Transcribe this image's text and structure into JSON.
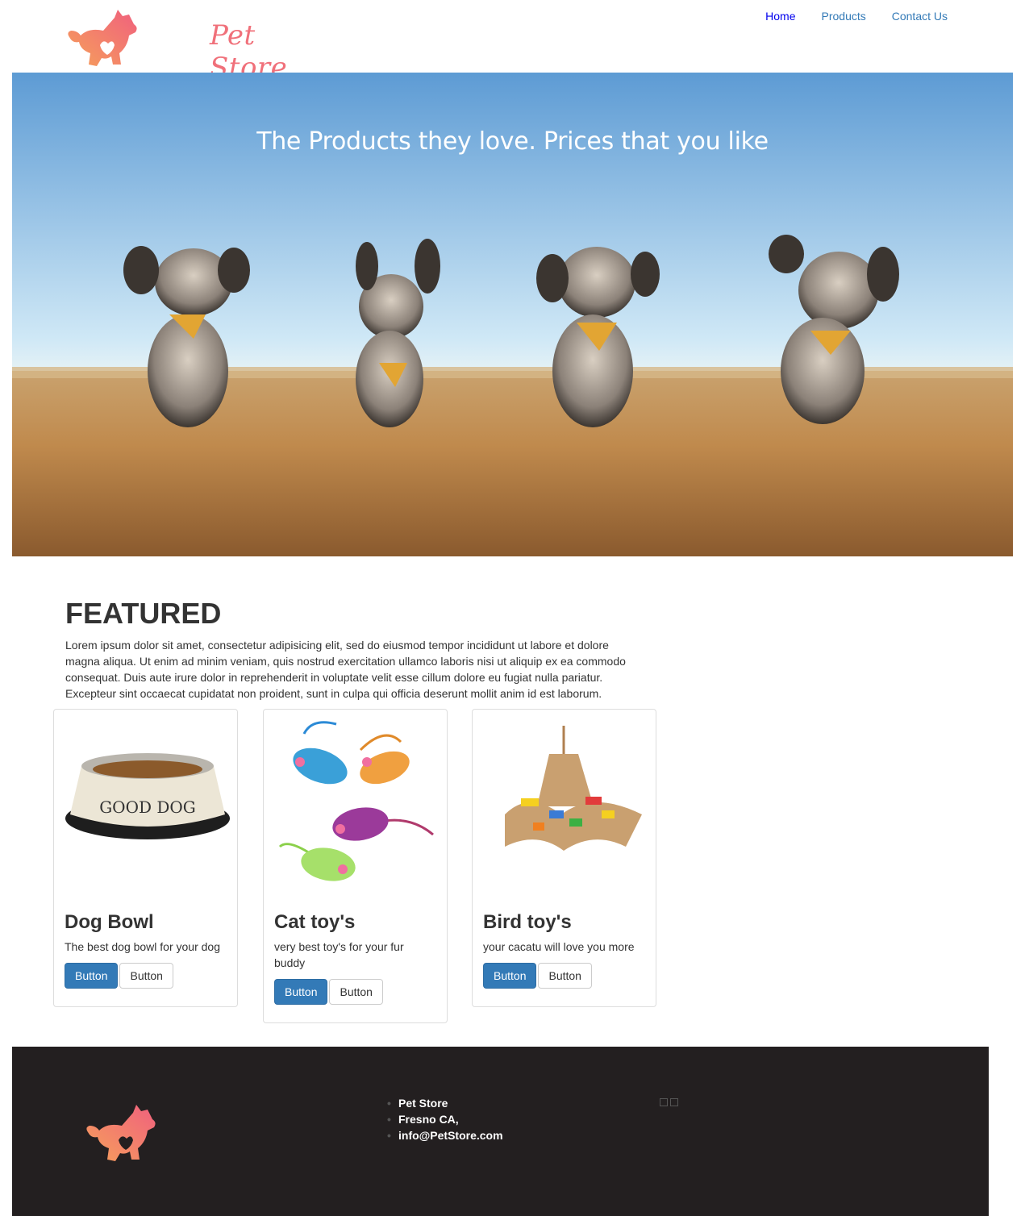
{
  "header": {
    "brand": "Pet Store",
    "nav": [
      {
        "label": "Home"
      },
      {
        "label": "Products"
      },
      {
        "label": "Contact Us"
      }
    ]
  },
  "hero": {
    "title": "The Products they love. Prices that you like"
  },
  "featured": {
    "title": "FEATURED",
    "text": "Lorem ipsum dolor sit amet, consectetur adipisicing elit, sed do eiusmod tempor incididunt ut labore et dolore magna aliqua. Ut enim ad minim veniam, quis nostrud exercitation ullamco laboris nisi ut aliquip ex ea commodo consequat. Duis aute irure dolor in reprehenderit in voluptate velit esse cillum dolore eu fugiat nulla pariatur. Excepteur sint occaecat cupidatat non proident, sunt in culpa qui officia deserunt mollit anim id est laborum."
  },
  "products": [
    {
      "title": "Dog Bowl",
      "desc": "The best dog bowl for your dog",
      "image_text": "GOOD DOG",
      "btn_primary": "Button",
      "btn_default": "Button"
    },
    {
      "title": "Cat toy's",
      "desc": "very best toy's for your fur buddy",
      "btn_primary": "Button",
      "btn_default": "Button"
    },
    {
      "title": "Bird toy's",
      "desc": "your cacatu will love you more",
      "btn_primary": "Button",
      "btn_default": "Button"
    }
  ],
  "footer": {
    "contact": [
      "Pet Store",
      "Fresno CA,",
      "info@PetStore.com"
    ]
  },
  "colors": {
    "brand": "#f0707a",
    "primary": "#337ab7",
    "footer_bg": "#231f20"
  }
}
